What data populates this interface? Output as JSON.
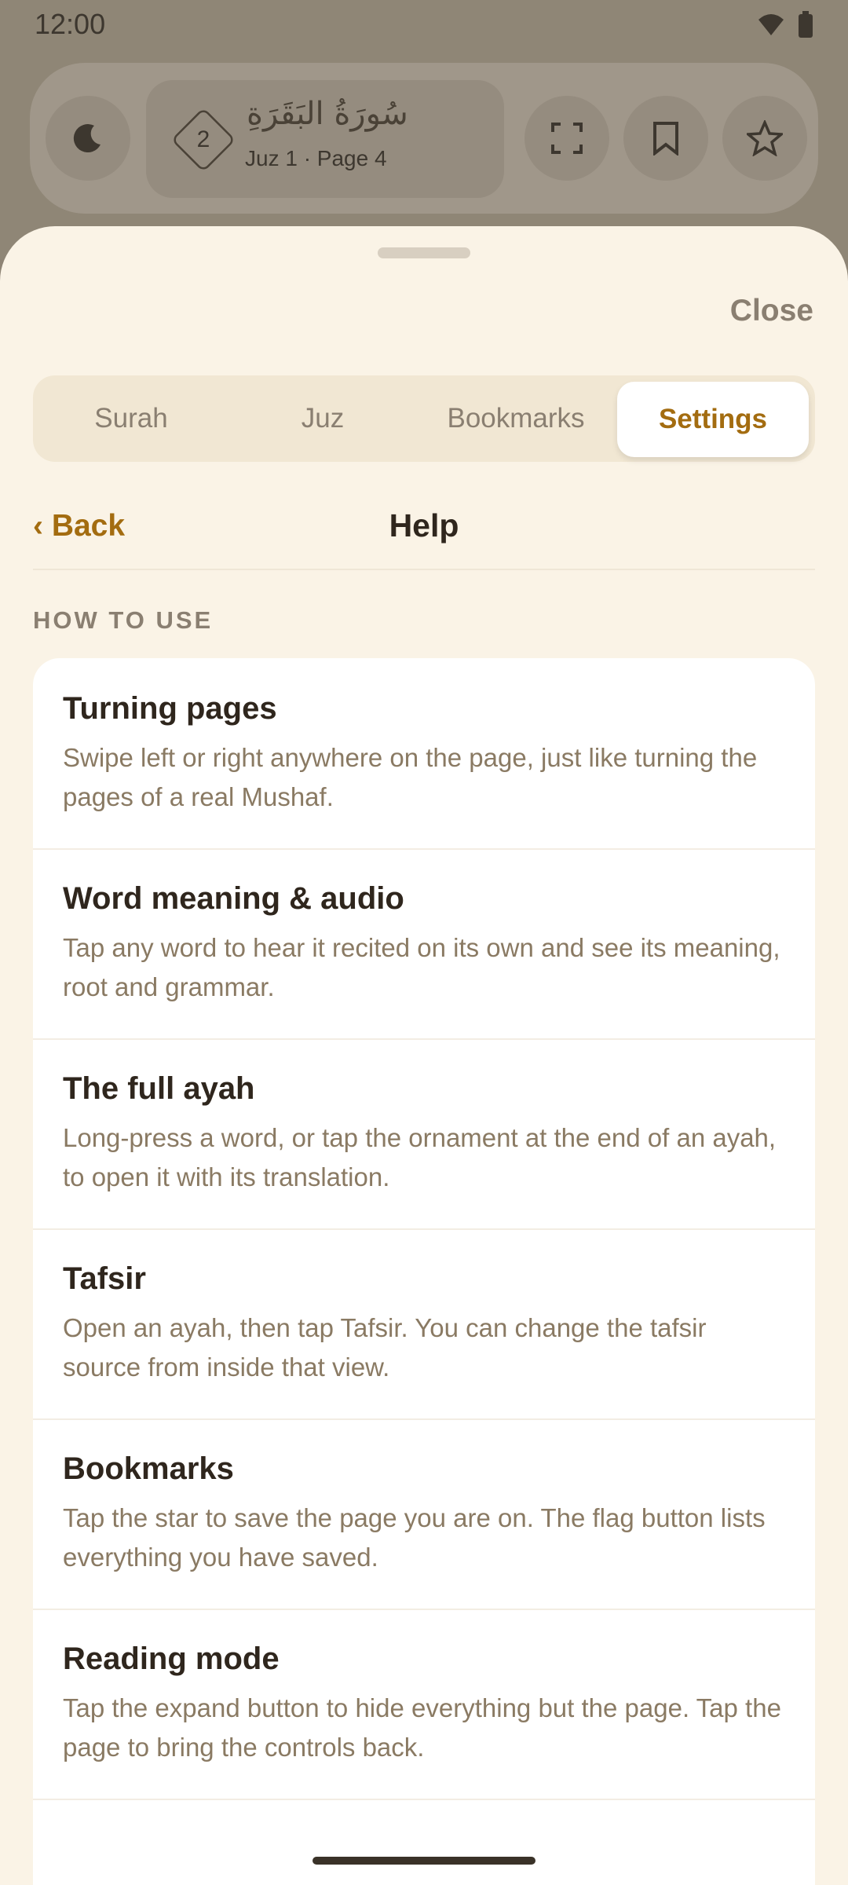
{
  "status_bar": {
    "time": "12:00",
    "icons": [
      "wifi-icon",
      "battery-icon"
    ]
  },
  "reader_toolbar": {
    "juz_number": "2",
    "surah_name_ar": "سُورَةُ البَقَرَةِ",
    "location": "Juz 1 · Page 4",
    "icons": [
      "moon-icon",
      "fullscreen-icon",
      "bookmark-icon",
      "star-icon"
    ]
  },
  "sheet": {
    "close_label": "Close",
    "tabs": [
      {
        "label": "Surah",
        "active": false
      },
      {
        "label": "Juz",
        "active": false
      },
      {
        "label": "Bookmarks",
        "active": false
      },
      {
        "label": "Settings",
        "active": true
      }
    ],
    "back_label": "‹ Back",
    "title": "Help",
    "section_label": "HOW TO USE",
    "items": [
      {
        "title": "Turning pages",
        "desc": "Swipe left or right anywhere on the page, just like turning the pages of a real Mushaf."
      },
      {
        "title": "Word meaning & audio",
        "desc": "Tap any word to hear it recited on its own and see its meaning, root and grammar."
      },
      {
        "title": "The full ayah",
        "desc": "Long-press a word, or tap the ornament at the end of an ayah, to open it with its translation."
      },
      {
        "title": "Tafsir",
        "desc": "Open an ayah, then tap Tafsir. You can change the tafsir source from inside that view."
      },
      {
        "title": "Bookmarks",
        "desc": "Tap the star to save the page you are on. The flag button lists everything you have saved."
      },
      {
        "title": "Reading mode",
        "desc": "Tap the expand button to hide everything but the page. Tap the page to bring the controls back."
      }
    ]
  },
  "colors": {
    "accent": "#a36c10",
    "sheet_bg": "#faf3e6",
    "scrim": "#8f8676"
  }
}
